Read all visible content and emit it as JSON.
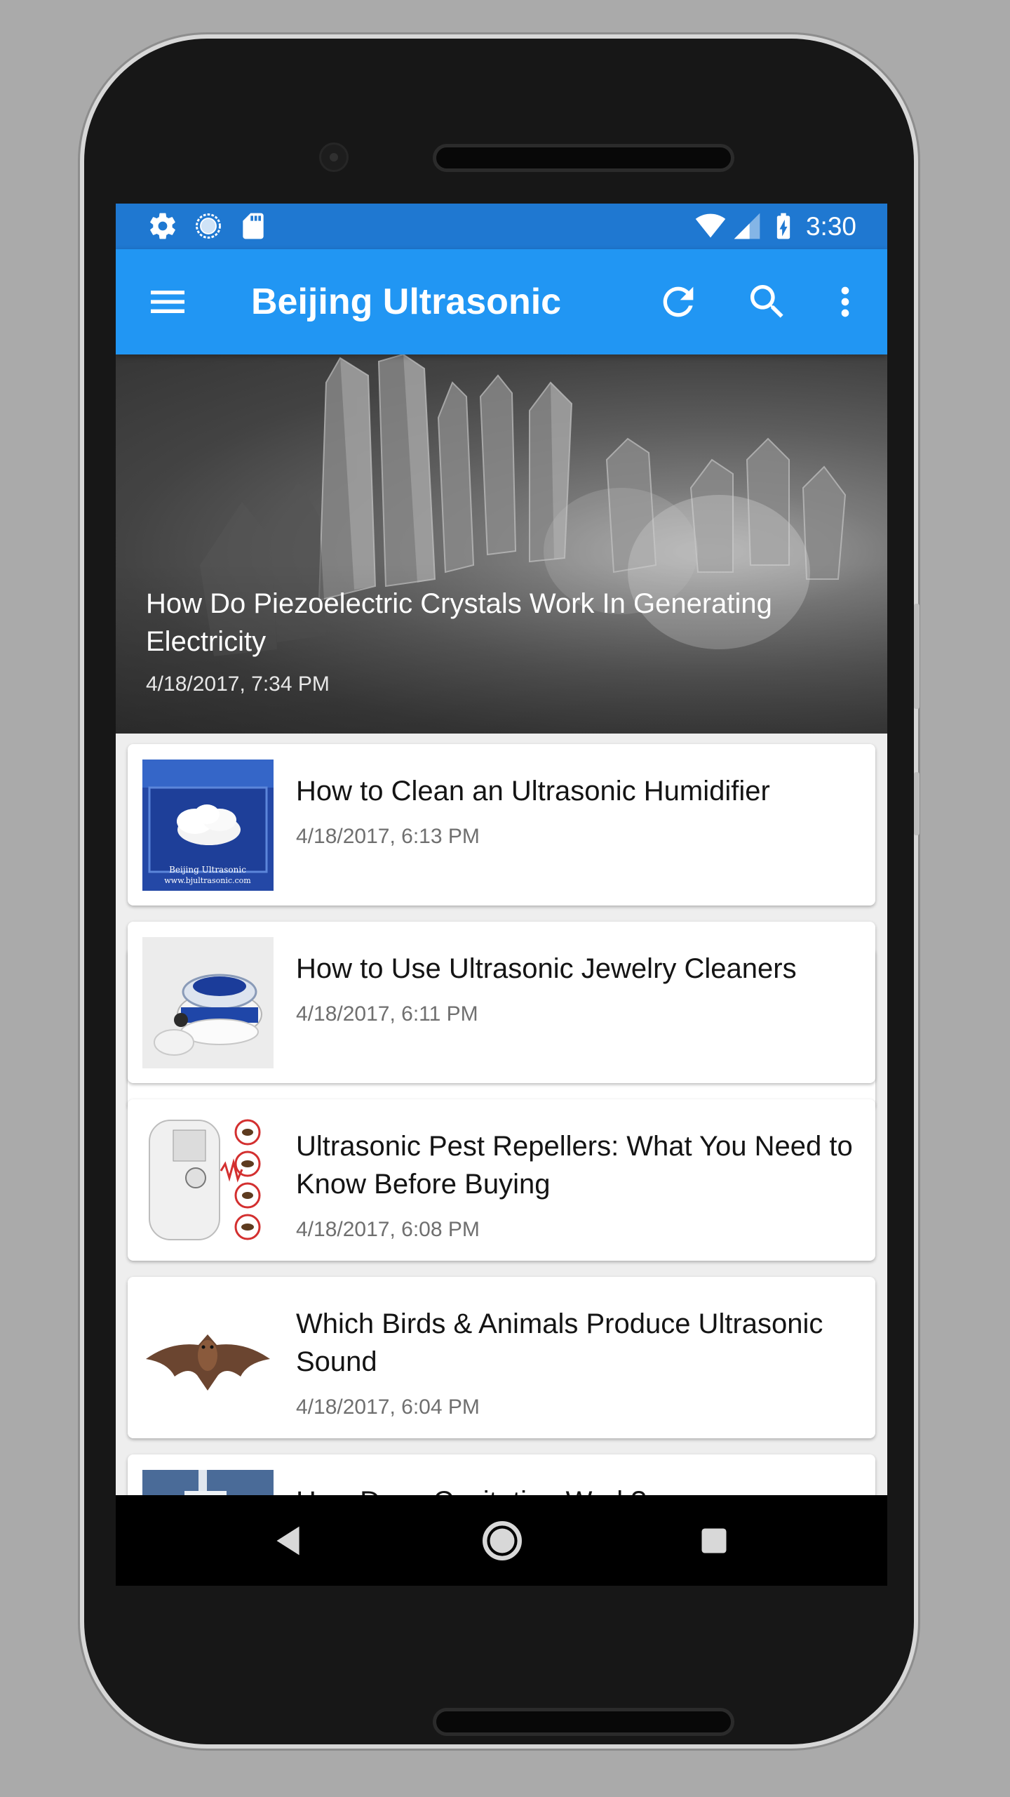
{
  "status_bar": {
    "time": "3:30",
    "left_icons": [
      "settings-icon",
      "sync-circle-icon",
      "sd-card-icon"
    ],
    "right_icons": [
      "wifi-icon",
      "cell-signal-icon",
      "battery-charging-icon"
    ]
  },
  "app_bar": {
    "title": "Beijing Ultrasonic",
    "menu_icon": "menu-icon",
    "actions": [
      "refresh-icon",
      "search-icon",
      "more-vertical-icon"
    ]
  },
  "hero": {
    "title": "How Do Piezoelectric Crystals Work In Generating Electricity",
    "date": "4/18/2017, 7:34 PM",
    "image": "quartz-crystals"
  },
  "articles": [
    {
      "title": "How to Clean an Ultrasonic Humidifier",
      "date": "4/18/2017, 6:13 PM",
      "thumb": "humidifier-mist",
      "thumb_caption_1": "Beijing Ultrasonic",
      "thumb_caption_2": "www.bjultrasonic.com"
    },
    {
      "title": "How to Use Ultrasonic Jewelry Cleaners",
      "date": "4/18/2017, 6:11 PM",
      "thumb": "jewelry-cleaner"
    },
    {
      "title": "Ultrasonic Pest Repellers: What You Need to Know Before Buying",
      "date": "4/18/2017, 6:08 PM",
      "thumb": "pest-repeller"
    },
    {
      "title": "Which Birds & Animals Produce Ultrasonic Sound",
      "date": "4/18/2017, 6:04 PM",
      "thumb": "bat"
    },
    {
      "title": "How Does Cavitation Work?",
      "date": "",
      "thumb": "cavitation"
    }
  ],
  "nav_bar": [
    "back-icon",
    "home-icon",
    "recents-icon"
  ],
  "colors": {
    "status_bar": "#1f78d1",
    "app_bar": "#2196f3",
    "background": "#eeeeee",
    "card": "#ffffff"
  }
}
